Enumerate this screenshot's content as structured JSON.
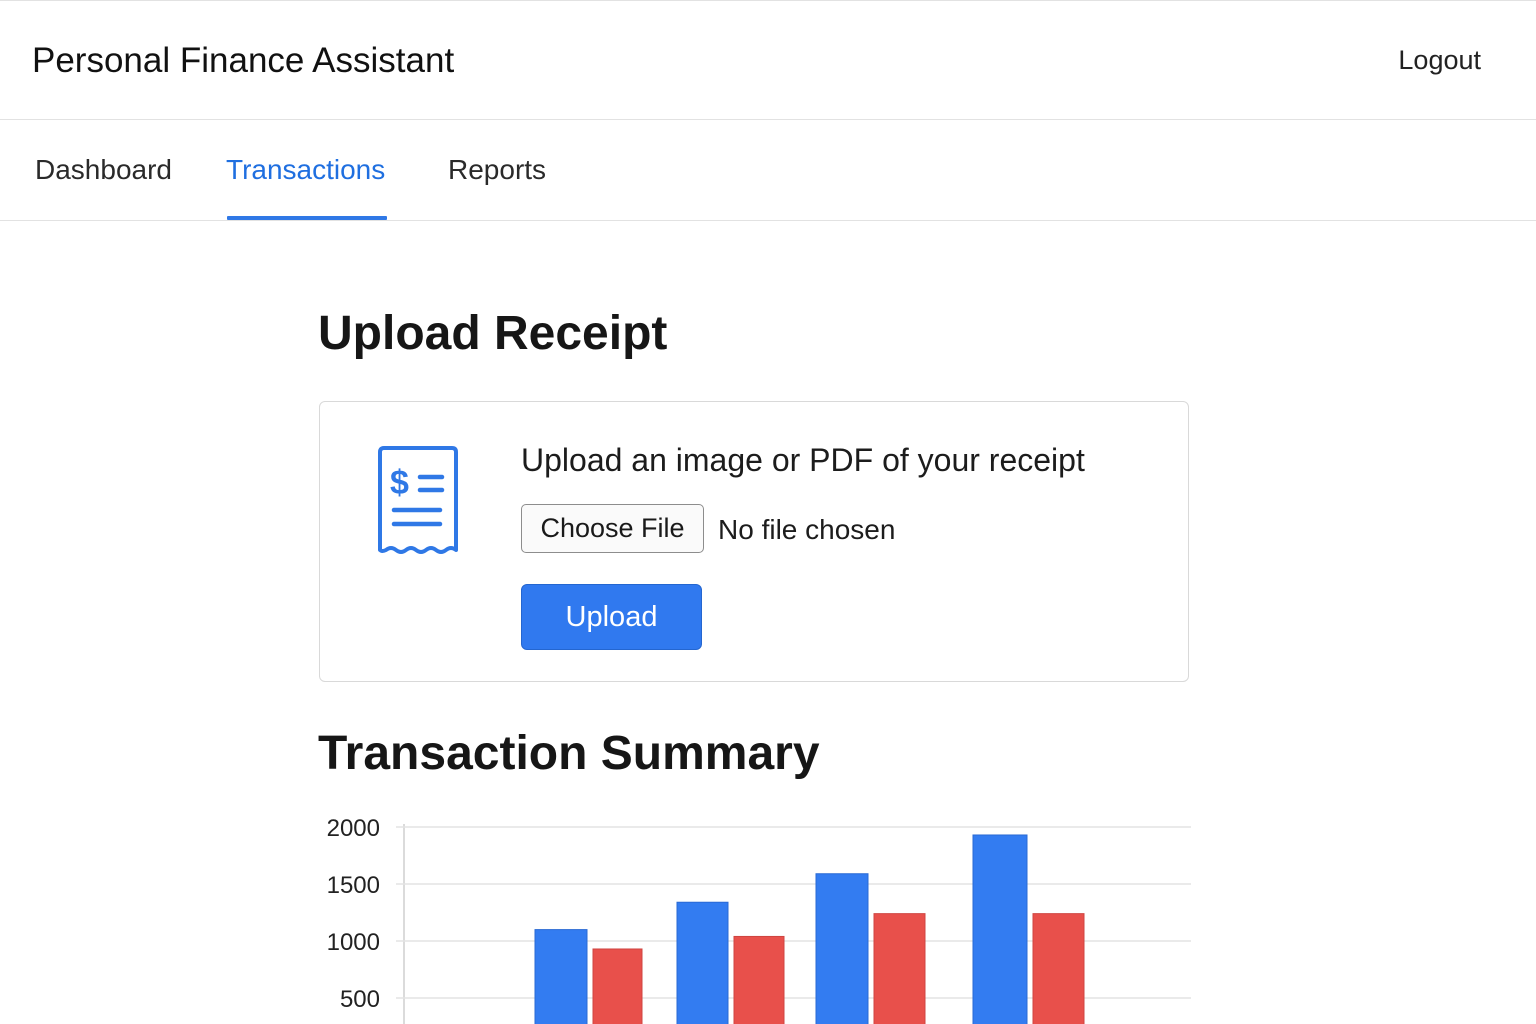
{
  "header": {
    "title": "Personal Finance Assistant",
    "logout_label": "Logout"
  },
  "tabs": [
    {
      "label": "Dashboard",
      "active": false
    },
    {
      "label": "Transactions",
      "active": true
    },
    {
      "label": "Reports",
      "active": false
    }
  ],
  "upload": {
    "title": "Upload Receipt",
    "prompt": "Upload an image or PDF of your receipt",
    "choose_file_label": "Choose File",
    "file_status": "No file chosen",
    "upload_label": "Upload",
    "icon": "receipt-icon"
  },
  "summary": {
    "title": "Transaction Summary"
  },
  "colors": {
    "accent": "#2f78e6",
    "income": "#337cf1",
    "expense": "#e8504b"
  },
  "chart_data": {
    "type": "bar",
    "categories": [
      "",
      "",
      "",
      ""
    ],
    "series": [
      {
        "values": [
          1100,
          1340,
          1590,
          1930
        ]
      },
      {
        "values": [
          930,
          1040,
          1240,
          1240
        ]
      }
    ],
    "yticks": [
      500,
      1000,
      1500,
      2000
    ],
    "ylim": [
      0,
      2000
    ],
    "grid": true
  }
}
